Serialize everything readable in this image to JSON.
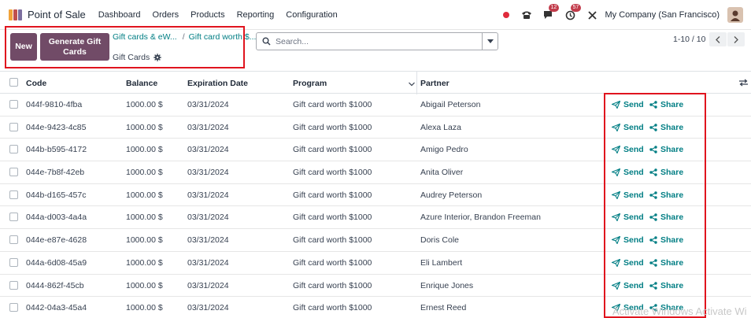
{
  "navbar": {
    "app_name": "Point of Sale",
    "menu": [
      "Dashboard",
      "Orders",
      "Products",
      "Reporting",
      "Configuration"
    ],
    "messages_badge": "12",
    "activities_badge": "57",
    "company": "My Company (San Francisco)"
  },
  "control": {
    "new_label": "New",
    "generate_label": "Generate Gift Cards",
    "breadcrumb_1": "Gift cards & eW...",
    "breadcrumb_sep": "/",
    "breadcrumb_2": "Gift card worth $...",
    "subtitle": "Gift Cards",
    "search_placeholder": "Search...",
    "pager": "1-10 / 10"
  },
  "table": {
    "headers": {
      "code": "Code",
      "balance": "Balance",
      "expiration": "Expiration Date",
      "program": "Program",
      "partner": "Partner"
    },
    "send_label": "Send",
    "share_label": "Share",
    "rows": [
      {
        "code": "044f-9810-4fba",
        "balance": "1000.00 $",
        "expiration": "03/31/2024",
        "program": "Gift card worth $1000",
        "partner": "Abigail Peterson"
      },
      {
        "code": "044e-9423-4c85",
        "balance": "1000.00 $",
        "expiration": "03/31/2024",
        "program": "Gift card worth $1000",
        "partner": "Alexa Laza"
      },
      {
        "code": "044b-b595-4172",
        "balance": "1000.00 $",
        "expiration": "03/31/2024",
        "program": "Gift card worth $1000",
        "partner": "Amigo Pedro"
      },
      {
        "code": "044e-7b8f-42eb",
        "balance": "1000.00 $",
        "expiration": "03/31/2024",
        "program": "Gift card worth $1000",
        "partner": "Anita Oliver"
      },
      {
        "code": "044b-d165-457c",
        "balance": "1000.00 $",
        "expiration": "03/31/2024",
        "program": "Gift card worth $1000",
        "partner": "Audrey Peterson"
      },
      {
        "code": "044a-d003-4a4a",
        "balance": "1000.00 $",
        "expiration": "03/31/2024",
        "program": "Gift card worth $1000",
        "partner": "Azure Interior, Brandon Freeman"
      },
      {
        "code": "044e-e87e-4628",
        "balance": "1000.00 $",
        "expiration": "03/31/2024",
        "program": "Gift card worth $1000",
        "partner": "Doris Cole"
      },
      {
        "code": "044a-6d08-45a9",
        "balance": "1000.00 $",
        "expiration": "03/31/2024",
        "program": "Gift card worth $1000",
        "partner": "Eli Lambert"
      },
      {
        "code": "0444-862f-45cb",
        "balance": "1000.00 $",
        "expiration": "03/31/2024",
        "program": "Gift card worth $1000",
        "partner": "Enrique Jones"
      },
      {
        "code": "0442-04a3-45a4",
        "balance": "1000.00 $",
        "expiration": "03/31/2024",
        "program": "Gift card worth $1000",
        "partner": "Ernest Reed"
      }
    ]
  },
  "watermark": "Activate Windows Activate Wi",
  "colors": {
    "brand": "#714b67",
    "link": "#017e84",
    "highlight": "#e0141e"
  }
}
